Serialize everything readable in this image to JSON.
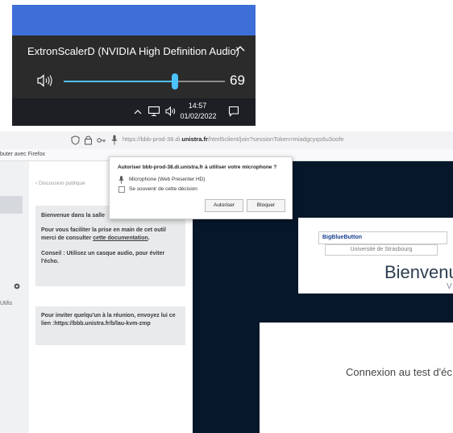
{
  "volume_flyout": {
    "device_name": "ExtronScalerD (NVIDIA High Definition Audio)",
    "volume_value": "69",
    "volume_level": 0.69,
    "icons": [
      "chevron-up-icon",
      "speaker-icon"
    ]
  },
  "taskbar": {
    "time": "14:57",
    "date": "01/02/2022",
    "icons": [
      "chevron-up-icon",
      "network-icon",
      "speaker-icon",
      "notification-icon"
    ]
  },
  "browser": {
    "url_prefix": "https://bbb-prod-38.di.",
    "url_domain": "unistra.fr",
    "url_rest": "/html5client/join?sessionToken=miadgcyqs6u3oofe",
    "bookmark_label": "buter avec Firefox"
  },
  "permission_popup": {
    "title": "Autoriser bbb-prod-38.di.unistra.fr à utiliser votre microphone ?",
    "device": "Microphone (Web Presenter HD)",
    "remember_label": "Se souvenir de cette décision",
    "allow_label": "Autoriser",
    "block_label": "Bloquer"
  },
  "sidebar": {
    "strip_text": "Utilis"
  },
  "chat": {
    "back_label": "‹ Discussion publique",
    "welcome": "Bienvenue dans la salle",
    "tip_text": "Pour vous faciliter la prise en main de cet outil merci de consulter",
    "tip_link": "cette documentation",
    "tip_end": ".",
    "advice": "Conseil : Utilisez un casque audio, pour éviter l'écho.",
    "invite": "Pour inviter quelqu'un à la réunion, envoyez lui ce lien :https://bbb.unistra.fr/b/lau-kvm-zmp"
  },
  "presentation": {
    "logo_text": "BigBlueButton",
    "university": "Université de Strasbourg",
    "title": "Bienvenu",
    "subtitle": "V"
  },
  "modal": {
    "text": "Connexion au test d'éc"
  },
  "colors": {
    "desktop_blue": "#3e6fd9",
    "flyout_bg": "#2b2b2b",
    "slider_accent": "#4cc2ff",
    "taskbar_bg": "#1d1f24",
    "presentation_bg": "#06172a"
  }
}
